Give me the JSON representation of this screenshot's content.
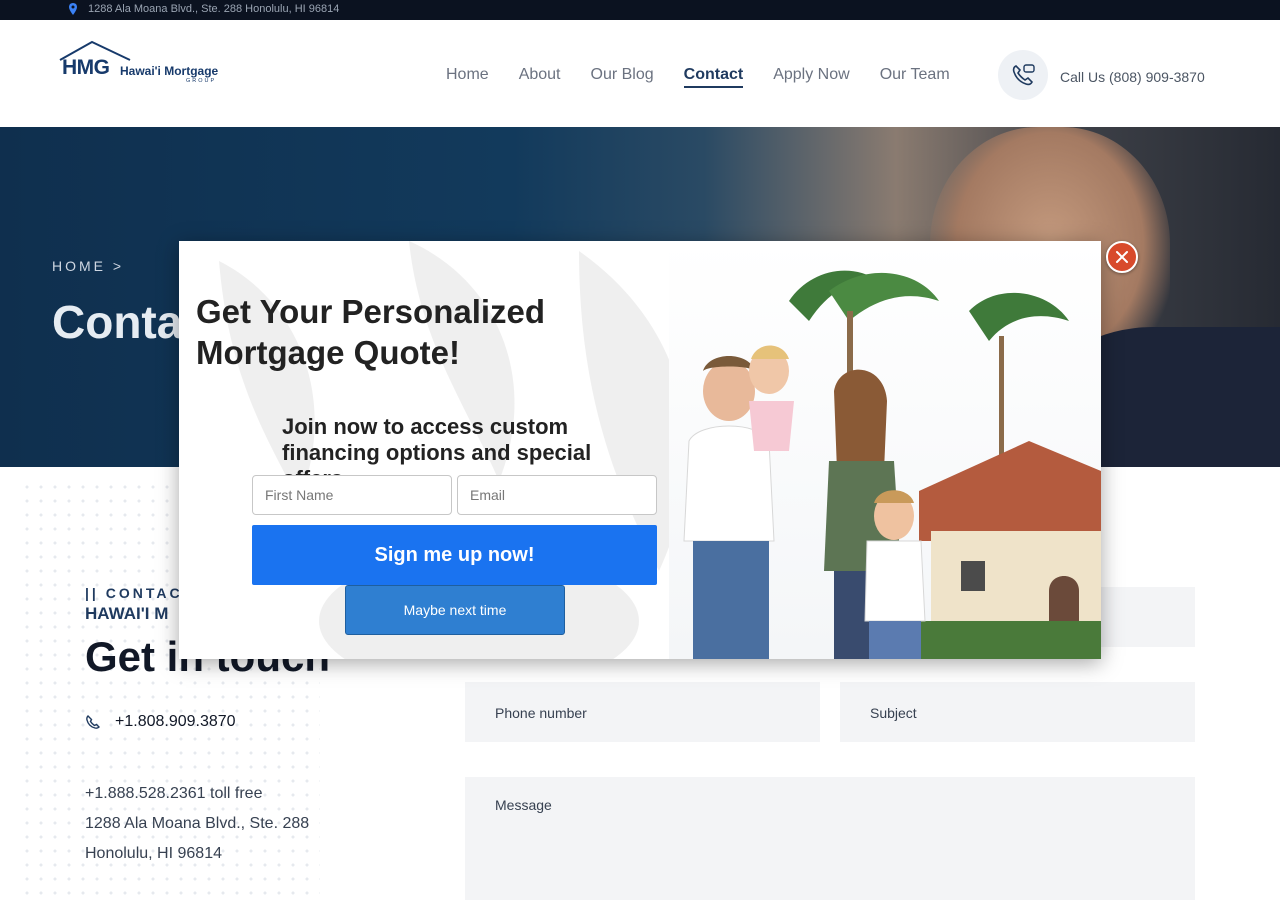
{
  "topbar": {
    "address": "1288 Ala Moana Blvd., Ste. 288 Honolulu, HI 96814",
    "icon": "map-pin-icon"
  },
  "brand": {
    "initials": "HMG",
    "name": "Hawai'i Mortgage",
    "group": "GROUP"
  },
  "nav": {
    "items": [
      "Home",
      "About",
      "Our Blog",
      "Contact",
      "Apply Now",
      "Our Team"
    ],
    "active": "Contact"
  },
  "header": {
    "call_label": "Call Us (808) 909-3870",
    "icon": "phone-icon"
  },
  "hero": {
    "breadcrumb": "HOME >",
    "title": "Conta"
  },
  "contact": {
    "eyebrow": "|| CONTAC",
    "subhead": "HAWAI'I M",
    "heading": "Get in touch",
    "phone": "+1.808.909.3870",
    "toll_free": "+1.888.528.2361 toll free",
    "address_line1": "1288 Ala Moana Blvd., Ste. 288",
    "address_line2": "Honolulu, HI 96814"
  },
  "form": {
    "phone_placeholder": "Phone number",
    "subject_placeholder": "Subject",
    "message_placeholder": "Message"
  },
  "popup": {
    "title": "Get Your Personalized Mortgage Quote!",
    "subtitle": "Join now to access custom financing options and special offers.",
    "first_name_placeholder": "First Name",
    "email_placeholder": "Email",
    "signup_label": "Sign me up now!",
    "dismiss_label": "Maybe next time",
    "close_icon": "close-icon"
  },
  "colors": {
    "accent": "#1a73f0",
    "navy": "#1f3a5f",
    "close": "#d84a2b"
  }
}
